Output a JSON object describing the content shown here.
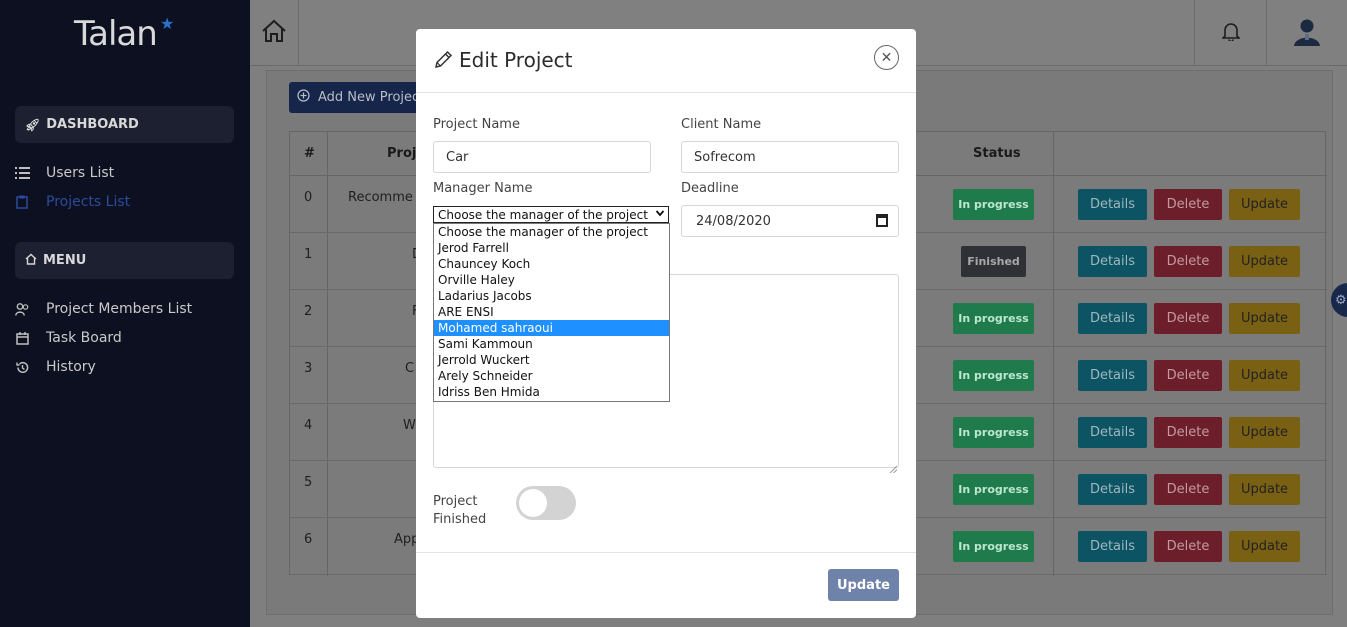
{
  "app": {
    "logo_text": "Talan"
  },
  "sidebar": {
    "dashboard_label": "DASHBOARD",
    "menu_label": "MENU",
    "top_items": [
      {
        "label": "Users List",
        "icon": "list-icon"
      },
      {
        "label": "Projects List",
        "icon": "clipboard-icon",
        "active": true
      }
    ],
    "menu_items": [
      {
        "label": "Project Members List",
        "icon": "users-icon"
      },
      {
        "label": "Task Board",
        "icon": "calendar-icon"
      },
      {
        "label": "History",
        "icon": "history-icon"
      }
    ]
  },
  "toolbar": {
    "add_project_label": "Add New Project"
  },
  "table": {
    "headers": {
      "num": "#",
      "project": "Proj",
      "status": "Status"
    },
    "rows": [
      {
        "num": "0",
        "name": "Recomme",
        "status": "In progress"
      },
      {
        "num": "1",
        "name": "D",
        "status": "Finished"
      },
      {
        "num": "2",
        "name": "F",
        "status": "In progress"
      },
      {
        "num": "3",
        "name": "C",
        "status": "In progress"
      },
      {
        "num": "4",
        "name": "W",
        "status": "In progress"
      },
      {
        "num": "5",
        "name": "",
        "status": "In progress"
      },
      {
        "num": "6",
        "name": "App",
        "status": "In progress"
      }
    ],
    "actions": {
      "details": "Details",
      "delete": "Delete",
      "update": "Update"
    }
  },
  "modal": {
    "title": "Edit Project",
    "project_name_label": "Project Name",
    "project_name_value": "Car",
    "client_name_label": "Client Name",
    "client_name_value": "Sofrecom",
    "manager_label": "Manager Name",
    "manager_selected": "Choose the manager of the project",
    "manager_options": [
      "Choose the manager of the project",
      "Jerod Farrell",
      "Chauncey Koch",
      "Orville Haley",
      "Ladarius Jacobs",
      "ARE ENSI",
      "Mohamed sahraoui",
      "Sami Kammoun",
      "Jerrold Wuckert",
      "Arely Schneider",
      "Idriss Ben Hmida"
    ],
    "highlighted_option_index": 6,
    "deadline_label": "Deadline",
    "deadline_value": "24/08/2020",
    "finished_label_line1": "Project",
    "finished_label_line2": "Finished",
    "finished_on": false,
    "update_label": "Update"
  },
  "colors": {
    "sidebar_bg": "#0d1020",
    "active_link": "#2b4b9c",
    "status_in_progress": "#1f7a4c",
    "status_finished": "#2f3136",
    "details_btn": "#0c5363",
    "delete_btn": "#6c1f2a",
    "update_btn": "#7a6013",
    "modal_update_btn": "#6e82aa",
    "highlight_option": "#1e90ff"
  }
}
